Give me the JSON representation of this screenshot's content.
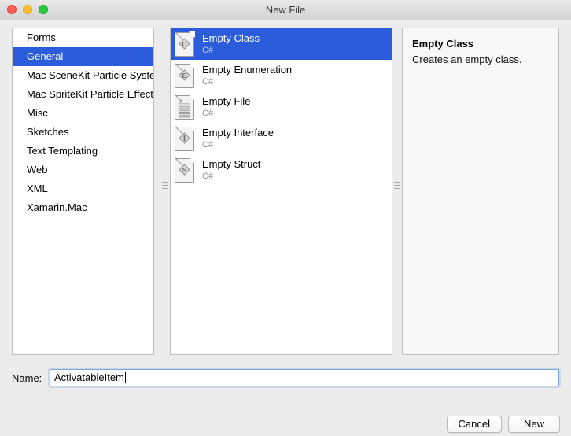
{
  "window": {
    "title": "New File",
    "traffic_lights": [
      "close-button",
      "minimize-button",
      "zoom-button"
    ],
    "accent_color": "#2a5cdb",
    "chrome_color": "#ececec"
  },
  "categories": {
    "selected": "General",
    "items": [
      {
        "label": "Forms"
      },
      {
        "label": "General"
      },
      {
        "label": "Mac SceneKit Particle System"
      },
      {
        "label": "Mac SpriteKit Particle Effects"
      },
      {
        "label": "Misc"
      },
      {
        "label": "Sketches"
      },
      {
        "label": "Text Templating"
      },
      {
        "label": "Web"
      },
      {
        "label": "XML"
      },
      {
        "label": "Xamarin.Mac"
      }
    ]
  },
  "templates": {
    "selected": "Empty Class",
    "items": [
      {
        "title": "Empty Class",
        "subtitle": "C#",
        "icon": "class-file-icon",
        "glyph": "C"
      },
      {
        "title": "Empty Enumeration",
        "subtitle": "C#",
        "icon": "enum-file-icon",
        "glyph": "E"
      },
      {
        "title": "Empty File",
        "subtitle": "C#",
        "icon": "text-file-icon",
        "glyph": "A"
      },
      {
        "title": "Empty Interface",
        "subtitle": "C#",
        "icon": "interface-file-icon",
        "glyph": "I"
      },
      {
        "title": "Empty Struct",
        "subtitle": "C#",
        "icon": "struct-file-icon",
        "glyph": "S"
      }
    ]
  },
  "description": {
    "title": "Empty Class",
    "text": "Creates an empty class."
  },
  "name_field": {
    "label": "Name:",
    "value": "ActivatableItem",
    "placeholder": ""
  },
  "buttons": {
    "cancel": "Cancel",
    "new": "New"
  }
}
